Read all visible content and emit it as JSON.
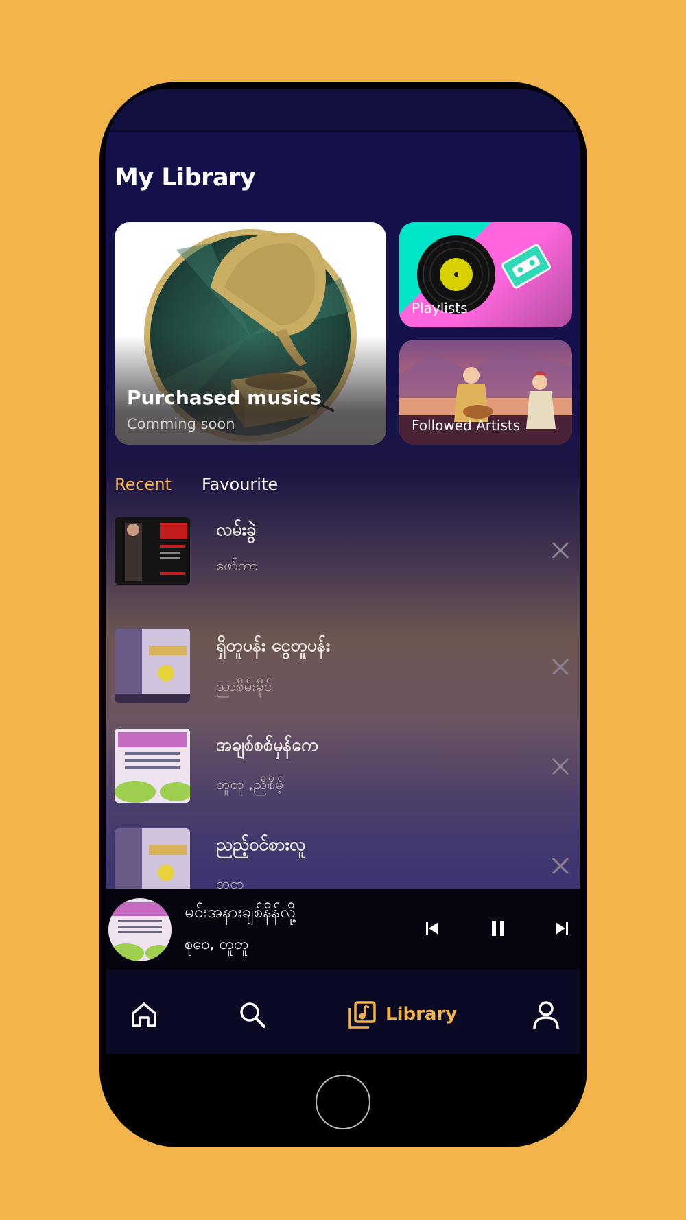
{
  "page": {
    "title": "My Library"
  },
  "cards": {
    "purchased": {
      "title": "Purchased musics",
      "subtitle": "Comming soon"
    },
    "playlists": {
      "label": "Playlists"
    },
    "followed_artists": {
      "label": "Followed Artists"
    }
  },
  "tabs": [
    {
      "label": "Recent",
      "active": true
    },
    {
      "label": "Favourite",
      "active": false
    }
  ],
  "recent_songs": [
    {
      "title": "လမ်းခွဲ",
      "artist": "ဖော်ကာ"
    },
    {
      "title": "ရှိတူပန်း ငွေတူပန်း",
      "artist": "ညာစိမ်းခိုင်"
    },
    {
      "title": "အချစ်စစ်မှန်ကေ",
      "artist": "တူတူ ,ညီစိမ့်"
    },
    {
      "title": "ညည့်ဝင်စားလူ",
      "artist": "တူတူ"
    }
  ],
  "now_playing": {
    "title": "မင်းအနားချစ်နိန်လို့",
    "artist": "စုဝေ, တူတူ",
    "state": "playing"
  },
  "bottom_nav": [
    {
      "name": "home",
      "icon": "home-icon",
      "label": ""
    },
    {
      "name": "search",
      "icon": "search-icon",
      "label": ""
    },
    {
      "name": "library",
      "icon": "library-icon",
      "label": "Library",
      "active": true
    },
    {
      "name": "profile",
      "icon": "profile-icon",
      "label": ""
    }
  ],
  "colors": {
    "background": "#F2B44A",
    "accent": "#F2B44A",
    "screen_top": "#14104a",
    "player_bg": "#05040f",
    "nav_bg": "#0b0a25"
  }
}
